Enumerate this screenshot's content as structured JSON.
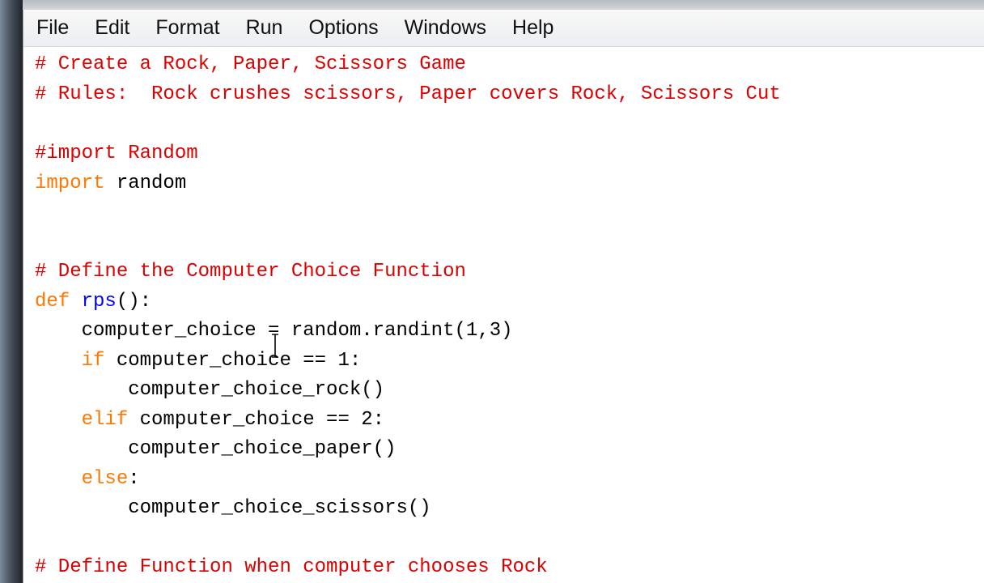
{
  "menu": [
    "File",
    "Edit",
    "Format",
    "Run",
    "Options",
    "Windows",
    "Help"
  ],
  "code": {
    "l1": "# Create a Rock, Paper, Scissors Game",
    "l2": "# Rules:  Rock crushes scissors, Paper covers Rock, Scissors Cut",
    "l4": "#import Random",
    "l5_kw": "import",
    "l5_rest": " random",
    "l8": "# Define the Computer Choice Function",
    "l9_kw": "def",
    "l9_sp": " ",
    "l9_name": "rps",
    "l9_rest": "():",
    "l10": "    computer_choice = random.randint(1,3)",
    "l11_indent": "    ",
    "l11_kw": "if",
    "l11_rest": " computer_choice == 1:",
    "l12": "        computer_choice_rock()",
    "l13_indent": "    ",
    "l13_kw": "elif",
    "l13_rest": " computer_choice == 2:",
    "l14": "        computer_choice_paper()",
    "l15_indent": "    ",
    "l15_kw": "else",
    "l15_rest": ":",
    "l16": "        computer_choice_scissors()",
    "l18": "# Define Function when computer chooses Rock"
  },
  "colors": {
    "comment": "#dd0000",
    "keyword": "#ff7700",
    "definition": "#0000ff",
    "text": "#000000"
  }
}
